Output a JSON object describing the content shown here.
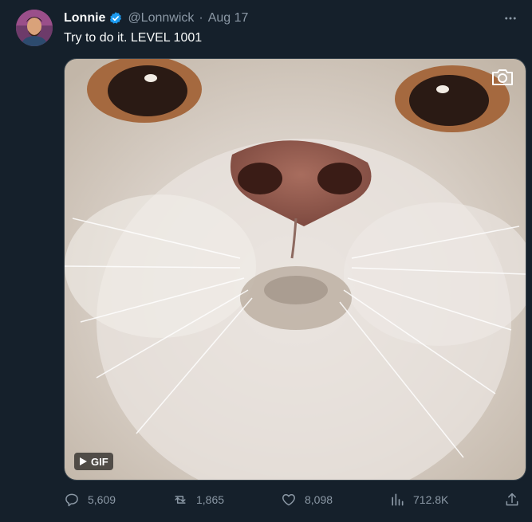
{
  "tweet": {
    "name": "Lonnie",
    "handle": "@Lonnwick",
    "separator": "·",
    "date": "Aug 17",
    "text": "Try to do it. LEVEL 1001",
    "media": {
      "badge": "GIF"
    },
    "actions": {
      "replies": "5,609",
      "retweets": "1,865",
      "likes": "8,098",
      "views": "712.8K"
    }
  },
  "icons": {
    "verified": "verified-badge-icon",
    "more": "more-dots-icon",
    "camera": "camera-icon",
    "play": "play-icon",
    "reply": "reply-icon",
    "retweet": "retweet-icon",
    "like": "heart-icon",
    "views": "bar-chart-icon",
    "share": "share-icon"
  },
  "colors": {
    "background": "#15202b",
    "text": "#f7f9f9",
    "muted": "#8b98a5",
    "accent": "#1d9bf0"
  }
}
